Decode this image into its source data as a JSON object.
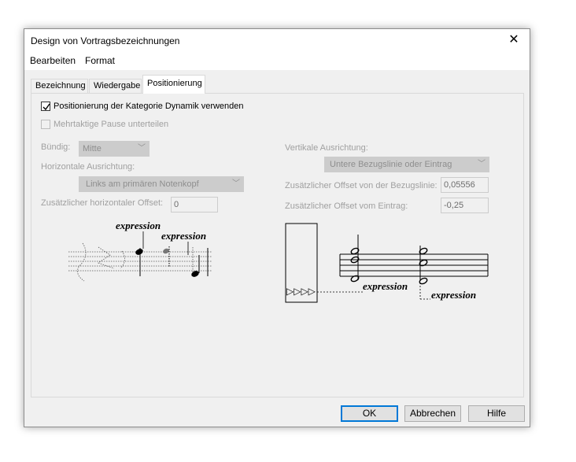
{
  "window": {
    "title": "Design von Vortragsbezeichnungen",
    "close_glyph": "✕"
  },
  "menu": [
    "Bearbeiten",
    "Format"
  ],
  "tabs": [
    "Bezeichnung",
    "Wiedergabe",
    "Positionierung"
  ],
  "active_tab": "Positionierung",
  "panel": {
    "use_category_checkbox": {
      "label": "Positionierung der Kategorie Dynamik verwenden",
      "checked": true
    },
    "split_rest_checkbox": {
      "label": "Mehrtaktige Pause unterteilen",
      "checked": false,
      "enabled": false
    },
    "alignment_label": "Bündig:",
    "alignment_value": "Mitte",
    "horizontal_label": "Horizontale Ausrichtung:",
    "horizontal_value": "Links am primären Notenkopf",
    "horizontal_offset_label": "Zusätzlicher horizontaler Offset:",
    "horizontal_offset_value": "0",
    "vertical_label": "Vertikale Ausrichtung:",
    "vertical_value": "Untere Bezugslinie oder Eintrag",
    "offset_baseline_label": "Zusätzlicher Offset von der Bezugslinie:",
    "offset_baseline_value": "0,05556",
    "offset_entry_label": "Zusätzlicher Offset vom Eintrag:",
    "offset_entry_value": "-0,25",
    "preview_text": "expression"
  },
  "buttons": {
    "ok": "OK",
    "cancel": "Abbrechen",
    "help": "Hilfe"
  },
  "icons": {
    "dropdown": "chevron-down-icon",
    "check": "checkmark-icon",
    "close": "close-icon"
  },
  "colors": {
    "accent": "#0078d7",
    "disabled_bg": "#cccccc"
  }
}
